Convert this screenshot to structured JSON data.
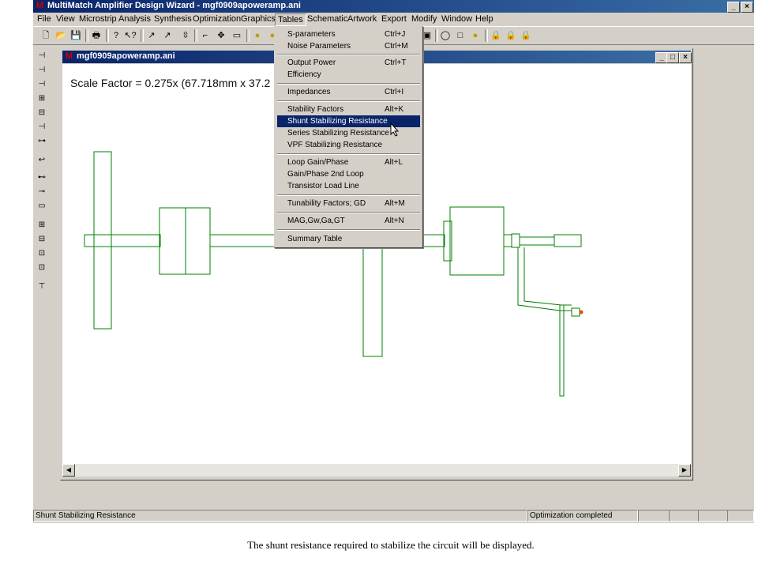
{
  "app": {
    "title": "MultiMatch Amplifier Design Wizard - mgf0909apoweramp.ani",
    "icon_letter": "M"
  },
  "menu": [
    "File",
    "View",
    "Microstrip",
    "Analysis",
    "Synthesis",
    "Optimization",
    "Graphics",
    "Tables",
    "Schematic",
    "Artwork",
    "Export",
    "Modify",
    "Window",
    "Help"
  ],
  "active_menu": "Tables",
  "tables_menu": [
    {
      "label": "S-parameters",
      "shortcut": "Ctrl+J"
    },
    {
      "label": "Noise Parameters",
      "shortcut": "Ctrl+M"
    },
    {
      "label": "Output Power",
      "shortcut": "Ctrl+T"
    },
    {
      "label": "Efficiency",
      "shortcut": ""
    },
    {
      "label": "Impedances",
      "shortcut": "Ctrl+I"
    },
    {
      "label": "Stability Factors",
      "shortcut": "Alt+K"
    },
    {
      "label": "Shunt Stabilizing Resistance",
      "shortcut": ""
    },
    {
      "label": "Series Stabilizing Resistance",
      "shortcut": ""
    },
    {
      "label": "VPF Stabilizing Resistance",
      "shortcut": ""
    },
    {
      "label": "Loop Gain/Phase",
      "shortcut": "Alt+L"
    },
    {
      "label": "Gain/Phase 2nd Loop",
      "shortcut": ""
    },
    {
      "label": "Transistor Load Line",
      "shortcut": ""
    },
    {
      "label": "Tunability Factors; GD",
      "shortcut": "Alt+M"
    },
    {
      "label": "MAG,Gw,Ga,GT",
      "shortcut": "Alt+N"
    },
    {
      "label": "Summary Table",
      "shortcut": ""
    }
  ],
  "highlighted_item": "Shunt Stabilizing Resistance",
  "child_window": {
    "title": "mgf0909apoweramp.ani",
    "scale_text": "Scale Factor =  0.275x (67.718mm x 37.2"
  },
  "status": {
    "left": "Shunt Stabilizing Resistance",
    "right": "Optimization completed"
  },
  "caption": "The shunt resistance required to stabilize the circuit will be displayed.",
  "colors": {
    "layout_stroke": "#008000",
    "titlebar": "#0a246a",
    "menu_highlight": "#0a246a"
  }
}
